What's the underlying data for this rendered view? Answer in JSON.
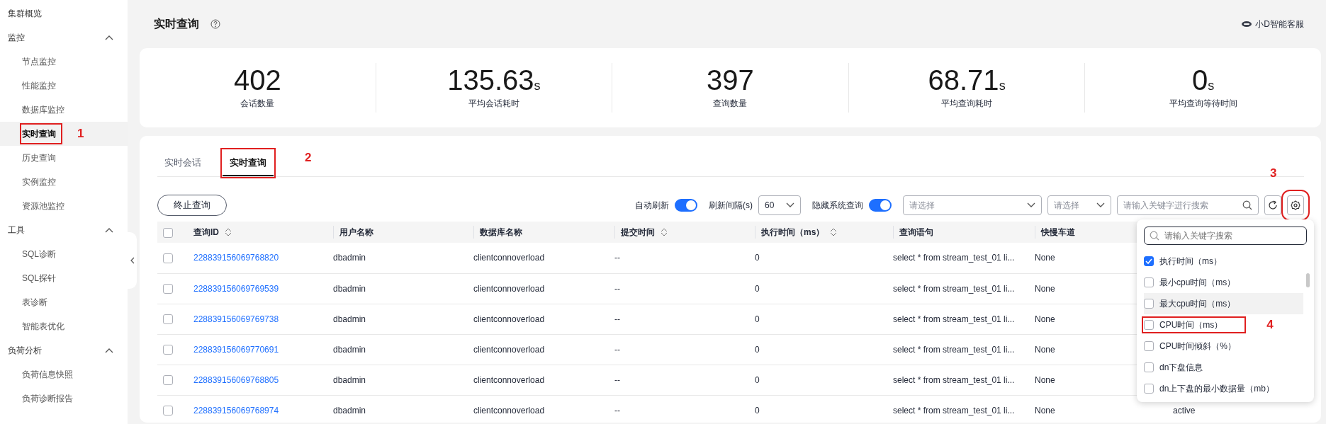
{
  "sidebar": {
    "items": [
      {
        "label": "集群概览",
        "selected": false
      },
      {
        "label": "监控",
        "expanded": true,
        "children": [
          {
            "label": "节点监控",
            "selected": false
          },
          {
            "label": "性能监控",
            "selected": false
          },
          {
            "label": "数据库监控",
            "selected": false
          },
          {
            "label": "实时查询",
            "selected": true,
            "callout": "1"
          },
          {
            "label": "历史查询",
            "selected": false
          },
          {
            "label": "实例监控",
            "selected": false
          },
          {
            "label": "资源池监控",
            "selected": false
          }
        ]
      },
      {
        "label": "工具",
        "expanded": true,
        "children": [
          {
            "label": "SQL诊断",
            "selected": false
          },
          {
            "label": "SQL探针",
            "selected": false
          },
          {
            "label": "表诊断",
            "selected": false
          },
          {
            "label": "智能表优化",
            "selected": false
          }
        ]
      },
      {
        "label": "负荷分析",
        "expanded": true,
        "children": [
          {
            "label": "负荷信息快照",
            "selected": false
          },
          {
            "label": "负荷诊断报告",
            "selected": false
          }
        ]
      }
    ]
  },
  "header": {
    "title": "实时查询",
    "assistant": "小D智能客服"
  },
  "stats": [
    {
      "value": "402",
      "label": "会话数量"
    },
    {
      "value": "135.63",
      "unit": "s",
      "label": "平均会话耗时"
    },
    {
      "value": "397",
      "label": "查询数量"
    },
    {
      "value": "68.71",
      "unit": "s",
      "label": "平均查询耗时"
    },
    {
      "value": "0",
      "unit": "s",
      "label": "平均查询等待时间"
    }
  ],
  "tabs": [
    {
      "label": "实时会话",
      "selected": false
    },
    {
      "label": "实时查询",
      "selected": true,
      "callout": "2"
    }
  ],
  "toolbar": {
    "terminate_button": "终止查询",
    "auto_refresh": {
      "label": "自动刷新",
      "on": true
    },
    "interval": {
      "label": "刷新间隔(s)",
      "value": "60"
    },
    "hide_system": {
      "label": "隐藏系统查询",
      "on": true
    },
    "select_1": {
      "placeholder": "请选择"
    },
    "select_2": {
      "placeholder": "请选择"
    },
    "search": {
      "placeholder": "请输入关键字进行搜索"
    },
    "settings_callout": "3"
  },
  "table": {
    "all_checked": false,
    "columns": [
      {
        "label": "查询ID",
        "sortable": true
      },
      {
        "label": "用户名称",
        "sortable": false
      },
      {
        "label": "数据库名称",
        "sortable": false
      },
      {
        "label": "提交时间",
        "sortable": true
      },
      {
        "label": "执行时间（ms）",
        "sortable": true
      },
      {
        "label": "查询语句",
        "sortable": false
      },
      {
        "label": "快慢车道",
        "sortable": false
      }
    ],
    "rows": [
      {
        "checked": false,
        "query_id": "228839156069768820",
        "user": "dbadmin",
        "database": "clientconnoverload",
        "submit_time": "--",
        "exec_time": "0",
        "statement": "select * from stream_test_01 li...",
        "lane": "None"
      },
      {
        "checked": false,
        "query_id": "228839156069769539",
        "user": "dbadmin",
        "database": "clientconnoverload",
        "submit_time": "--",
        "exec_time": "0",
        "statement": "select * from stream_test_01 li...",
        "lane": "None"
      },
      {
        "checked": false,
        "query_id": "228839156069769738",
        "user": "dbadmin",
        "database": "clientconnoverload",
        "submit_time": "--",
        "exec_time": "0",
        "statement": "select * from stream_test_01 li...",
        "lane": "None"
      },
      {
        "checked": false,
        "query_id": "228839156069770691",
        "user": "dbadmin",
        "database": "clientconnoverload",
        "submit_time": "--",
        "exec_time": "0",
        "statement": "select * from stream_test_01 li...",
        "lane": "None"
      },
      {
        "checked": false,
        "query_id": "228839156069768805",
        "user": "dbadmin",
        "database": "clientconnoverload",
        "submit_time": "--",
        "exec_time": "0",
        "statement": "select * from stream_test_01 li...",
        "lane": "None"
      },
      {
        "checked": false,
        "query_id": "228839156069768974",
        "user": "dbadmin",
        "database": "clientconnoverload",
        "submit_time": "--",
        "exec_time": "0",
        "statement": "select * from stream_test_01 li...",
        "lane": "None",
        "column_8": "active"
      }
    ]
  },
  "column_settings": {
    "search_placeholder": "请输入关键字搜索",
    "items": [
      {
        "label": "执行时间（ms）",
        "checked": true,
        "hovered": false
      },
      {
        "label": "最小cpu时间（ms）",
        "checked": false,
        "hovered": false
      },
      {
        "label": "最大cpu时间（ms）",
        "checked": false,
        "hovered": true
      },
      {
        "label": "CPU时间（ms）",
        "checked": false,
        "hovered": false,
        "callout": "4"
      },
      {
        "label": "CPU时间倾斜（%）",
        "checked": false,
        "hovered": false
      },
      {
        "label": "dn下盘信息",
        "checked": false,
        "hovered": false
      },
      {
        "label": "dn上下盘的最小数据量（mb）",
        "checked": false,
        "hovered": false
      }
    ]
  }
}
